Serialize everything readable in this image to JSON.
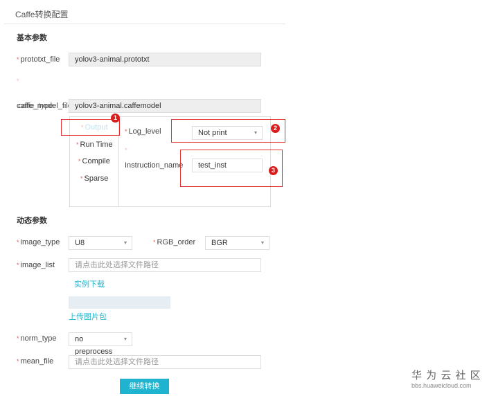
{
  "title": "Caffe转换配置",
  "basic": {
    "heading": "基本参数",
    "prototxt_label": "prototxt_file",
    "prototxt_value": "yolov3-animal.prototxt",
    "caffemodel_label": "caffe_model_file",
    "caffemodel_overlap_label": "caffe_type",
    "caffemodel_value": "yolov3-animal.caffemodel"
  },
  "advanced": {
    "tabs": [
      {
        "label": "Output",
        "active": true
      },
      {
        "label": "Run Time"
      },
      {
        "label": "Compile"
      },
      {
        "label": "Sparse"
      }
    ],
    "log_level_label": "Log_level",
    "log_level_value": "Not print",
    "instruction_label": "Instruction_name",
    "instruction_value": "test_inst",
    "badges": [
      "1",
      "2",
      "3"
    ]
  },
  "dynamic": {
    "heading": "动态参数",
    "image_type_label": "image_type",
    "image_type_value": "U8",
    "rgb_order_label": "RGB_order",
    "rgb_order_value": "BGR",
    "image_list_label": "image_list",
    "image_list_placeholder": "请点击此处选择文件路径",
    "example_download": "实例下载",
    "upload_images": "上传图片包",
    "norm_type_label": "norm_type",
    "norm_type_value": "no preprocess",
    "mean_file_label": "mean_file",
    "mean_file_placeholder": "请点击此处选择文件路径"
  },
  "submit": "继续转换",
  "watermark": {
    "title": "华 为 云 社 区",
    "url": "bbs.huaweicloud.com"
  },
  "colors": {
    "accent": "#1fb3cf",
    "required": "#e0605a",
    "annotation": "#d91d1d"
  }
}
